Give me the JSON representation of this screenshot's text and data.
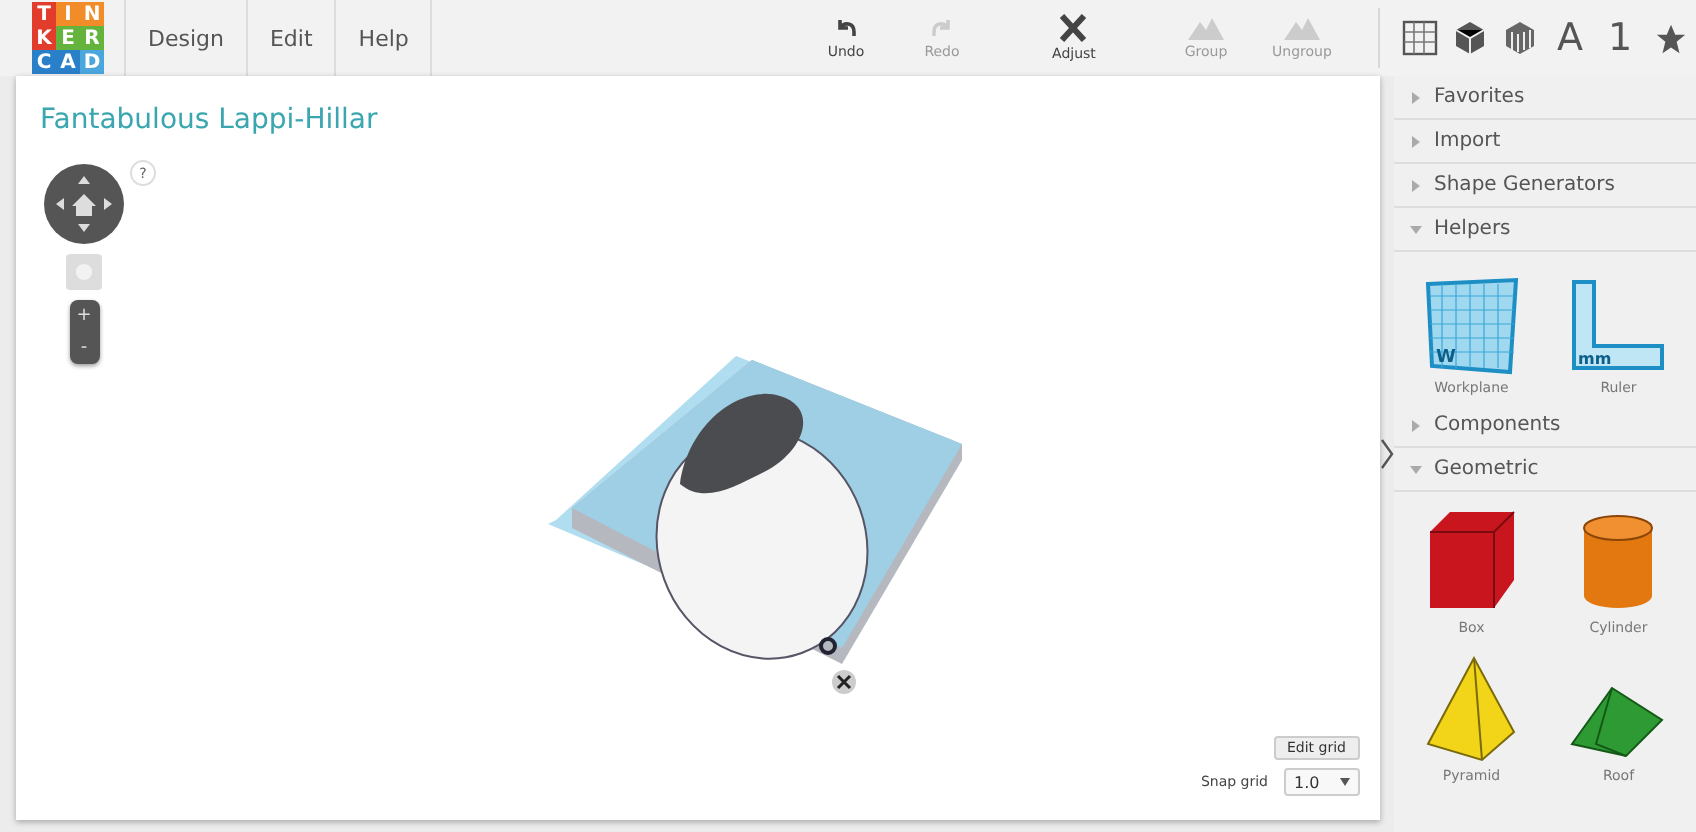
{
  "logo": {
    "letters": [
      {
        "char": "T",
        "color": "#e23c2c"
      },
      {
        "char": "I",
        "color": "#f28c28"
      },
      {
        "char": "N",
        "color": "#f28c28"
      },
      {
        "char": "K",
        "color": "#e23c2c"
      },
      {
        "char": "E",
        "color": "#63b33d"
      },
      {
        "char": "R",
        "color": "#63b33d"
      },
      {
        "char": "C",
        "color": "#2a80c8"
      },
      {
        "char": "A",
        "color": "#2a80c8"
      },
      {
        "char": "D",
        "color": "#4aa6dc"
      }
    ]
  },
  "menu": [
    "Design",
    "Edit",
    "Help"
  ],
  "toolbar": [
    {
      "kind": "undo",
      "label": "Undo",
      "disabled": false
    },
    {
      "kind": "redo",
      "label": "Redo",
      "disabled": true
    },
    {
      "kind": "adjust",
      "label": "Adjust",
      "disabled": false
    },
    {
      "kind": "group",
      "label": "Group",
      "disabled": true
    },
    {
      "kind": "ungroup",
      "label": "Ungroup",
      "disabled": true
    }
  ],
  "view_buttons": [
    {
      "kind": "grid"
    },
    {
      "kind": "cube"
    },
    {
      "kind": "pattern"
    },
    {
      "kind": "text",
      "label": "A"
    },
    {
      "kind": "text",
      "label": "1"
    },
    {
      "kind": "star"
    }
  ],
  "design_title": "Fantabulous Lappi-Hillar",
  "help": "?",
  "zoom": {
    "in": "+",
    "out": "-"
  },
  "edit_grid": "Edit grid",
  "snap_grid": {
    "label": "Snap grid",
    "value": "1.0"
  },
  "sidebar": [
    {
      "label": "Favorites",
      "expanded": false
    },
    {
      "label": "Import",
      "expanded": false
    },
    {
      "label": "Shape Generators",
      "expanded": false
    },
    {
      "label": "Helpers",
      "expanded": true,
      "items": [
        {
          "kind": "workplane",
          "label": "Workplane",
          "tag": "W"
        },
        {
          "kind": "ruler",
          "label": "Ruler",
          "tag": "mm"
        }
      ]
    },
    {
      "label": "Components",
      "expanded": false
    },
    {
      "label": "Geometric",
      "expanded": true,
      "items": [
        {
          "kind": "box",
          "label": "Box"
        },
        {
          "kind": "cylinder",
          "label": "Cylinder"
        },
        {
          "kind": "pyramid",
          "label": "Pyramid"
        },
        {
          "kind": "roof",
          "label": "Roof"
        }
      ]
    }
  ]
}
